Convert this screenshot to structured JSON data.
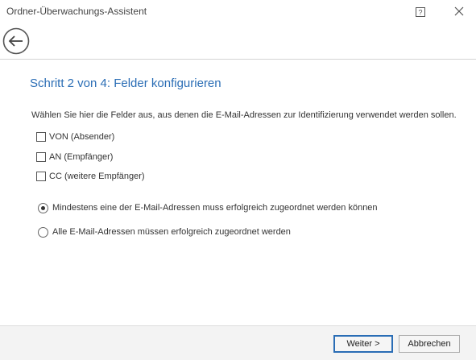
{
  "window": {
    "title": "Ordner-Überwachungs-Assistent"
  },
  "icons": {
    "help": "help-icon",
    "close": "close-icon",
    "back": "back-arrow-icon"
  },
  "page": {
    "title": "Schritt 2 von 4: Felder konfigurieren",
    "instruction": "Wählen Sie hier die Felder aus, aus denen die E-Mail-Adressen zur Identifizierung verwendet werden sollen."
  },
  "fields": [
    {
      "label": "VON (Absender)",
      "checked": false
    },
    {
      "label": "AN (Empfänger)",
      "checked": false
    },
    {
      "label": "CC (weitere Empfänger)",
      "checked": false
    }
  ],
  "match_options": [
    {
      "label": "Mindestens eine der E-Mail-Adressen muss erfolgreich zugeordnet werden können",
      "selected": true
    },
    {
      "label": "Alle E-Mail-Adressen müssen erfolgreich zugeordnet werden",
      "selected": false
    }
  ],
  "footer": {
    "next_label": "Weiter >",
    "cancel_label": "Abbrechen"
  },
  "colors": {
    "accent": "#2a6db5",
    "footer_bg": "#f3f3f3"
  }
}
